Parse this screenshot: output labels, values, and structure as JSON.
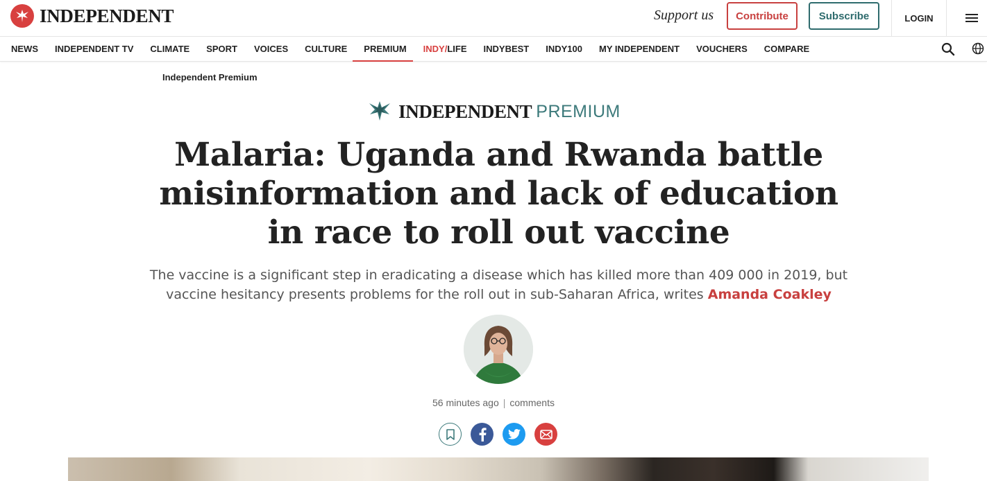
{
  "header": {
    "brand": "INDEPENDENT",
    "support_text": "Support us",
    "contribute_label": "Contribute",
    "subscribe_label": "Subscribe",
    "login_label": "LOGIN"
  },
  "nav": {
    "items": [
      {
        "label": "NEWS"
      },
      {
        "label": "INDEPENDENT TV"
      },
      {
        "label": "CLIMATE"
      },
      {
        "label": "SPORT"
      },
      {
        "label": "VOICES"
      },
      {
        "label": "CULTURE"
      },
      {
        "label": "PREMIUM",
        "active": true
      },
      {
        "label_prefix": "INDY/",
        "label_suffix": "LIFE"
      },
      {
        "label": "INDYBEST"
      },
      {
        "label": "INDY100"
      },
      {
        "label": "MY INDEPENDENT"
      },
      {
        "label": "VOUCHERS"
      },
      {
        "label": "COMPARE"
      }
    ]
  },
  "article": {
    "section": "Independent Premium",
    "premium_brand": "INDEPENDENT",
    "premium_word": "PREMIUM",
    "headline": "Malaria: Uganda and Rwanda battle misinformation and lack of education in race to roll out vaccine",
    "standfirst": "The vaccine is a significant step in eradicating a disease which has killed more than 409 000 in 2019, but vaccine hesitancy presents problems for the roll out in sub-Saharan Africa, writes",
    "author": "Amanda Coakley",
    "timestamp": "56 minutes ago",
    "separator": "|",
    "comments_label": "comments"
  },
  "icons": {
    "logo": "eagle-logo-icon",
    "menu": "hamburger-menu-icon",
    "search": "search-icon",
    "globe": "globe-icon",
    "bookmark": "bookmark-icon",
    "facebook": "facebook-icon",
    "twitter": "twitter-icon",
    "email": "email-icon"
  },
  "colors": {
    "brand_red": "#d8403f",
    "premium_teal": "#3d7a7b",
    "facebook_blue": "#3b5998",
    "twitter_blue": "#1d9bf0"
  }
}
